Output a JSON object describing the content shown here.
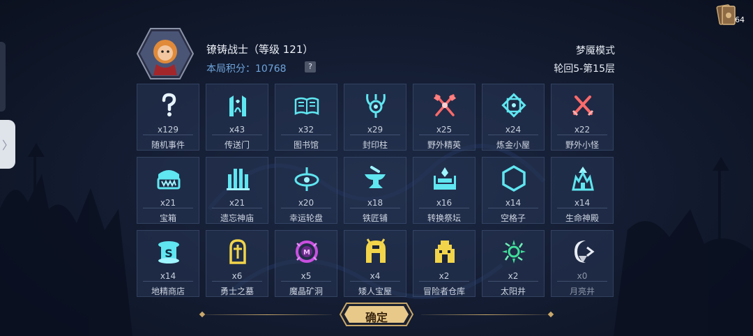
{
  "corner": {
    "icon": "card-deck-icon",
    "count": "64"
  },
  "header": {
    "hero_name": "镣铸战士（等级 121）",
    "score_label": "本局积分：10768",
    "help": "?",
    "mode": "梦魇模式",
    "round": "轮回5-第15层"
  },
  "tiles": [
    {
      "icon": "question-mark-icon",
      "count": "x129",
      "label": "随机事件"
    },
    {
      "icon": "portal-icon",
      "count": "x43",
      "label": "传送门"
    },
    {
      "icon": "book-icon",
      "count": "x32",
      "label": "图书馆"
    },
    {
      "icon": "seal-pillar-icon",
      "count": "x29",
      "label": "封印柱"
    },
    {
      "icon": "crossed-axes-icon",
      "count": "x25",
      "label": "野外精英"
    },
    {
      "icon": "alchemy-diamond-icon",
      "count": "x24",
      "label": "炼金小屋"
    },
    {
      "icon": "crossed-swords-icon",
      "count": "x22",
      "label": "野外小怪"
    },
    {
      "icon": "treasure-chest-icon",
      "count": "x21",
      "label": "宝箱"
    },
    {
      "icon": "temple-ruins-icon",
      "count": "x21",
      "label": "遗忘神庙"
    },
    {
      "icon": "fortune-wheel-icon",
      "count": "x20",
      "label": "幸运轮盘"
    },
    {
      "icon": "anvil-icon",
      "count": "x18",
      "label": "铁匠铺"
    },
    {
      "icon": "altar-icon",
      "count": "x16",
      "label": "转换祭坛"
    },
    {
      "icon": "hexagon-icon",
      "count": "x14",
      "label": "空格子"
    },
    {
      "icon": "life-shrine-icon",
      "count": "x14",
      "label": "生命神殿"
    },
    {
      "icon": "goblin-shop-icon",
      "count": "x14",
      "label": "地精商店"
    },
    {
      "icon": "tombstone-icon",
      "count": "x6",
      "label": "勇士之墓"
    },
    {
      "icon": "crystal-cave-icon",
      "count": "x5",
      "label": "魔晶矿洞"
    },
    {
      "icon": "dwarf-treasure-icon",
      "count": "x4",
      "label": "矮人宝屋"
    },
    {
      "icon": "warehouse-icon",
      "count": "x2",
      "label": "冒险者仓库"
    },
    {
      "icon": "sun-well-icon",
      "count": "x2",
      "label": "太阳井"
    },
    {
      "icon": "moon-well-icon",
      "count": "x0",
      "label": "月亮井"
    }
  ],
  "footer": {
    "confirm_label": "确定"
  }
}
